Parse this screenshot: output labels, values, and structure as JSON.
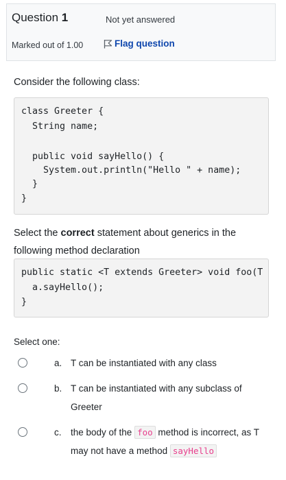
{
  "question": {
    "label": "Question",
    "number": "1",
    "state": "Not yet answered",
    "grade": "Marked out of 1.00",
    "flag_label": "Flag question"
  },
  "qtext": {
    "intro": "Consider the following class:",
    "code1": [
      "class Greeter {",
      "  String name;",
      "",
      "  public void sayHello() {",
      "    System.out.println(\"Hello \" + name);",
      "  }",
      "}"
    ],
    "para_pre": "Select the ",
    "para_bold": "correct",
    "para_post": " statement about generics in the following method declaration",
    "code2": [
      "public static <T extends Greeter> void foo(T a",
      "  a.sayHello();",
      "}"
    ]
  },
  "answer": {
    "prompt": "Select one:",
    "options": [
      {
        "letter": "a.",
        "text": "T can be instantiated with any class"
      },
      {
        "letter": "b.",
        "text": "T can be instantiated with any subclass of Greeter"
      },
      {
        "letter": "c.",
        "text_1": "the body of the ",
        "code_1": "foo",
        "text_2": " method is incorrect, as T may not have a method ",
        "code_2": "sayHello"
      }
    ]
  },
  "colors": {
    "flag_link": "#0f47ad",
    "inline_code": "#e83e8c",
    "info_background": "#f8f9fa",
    "code_background": "#f3f3f3"
  },
  "icons": {
    "flag": "flag-outline-icon",
    "radio": "radio-unchecked-icon"
  }
}
